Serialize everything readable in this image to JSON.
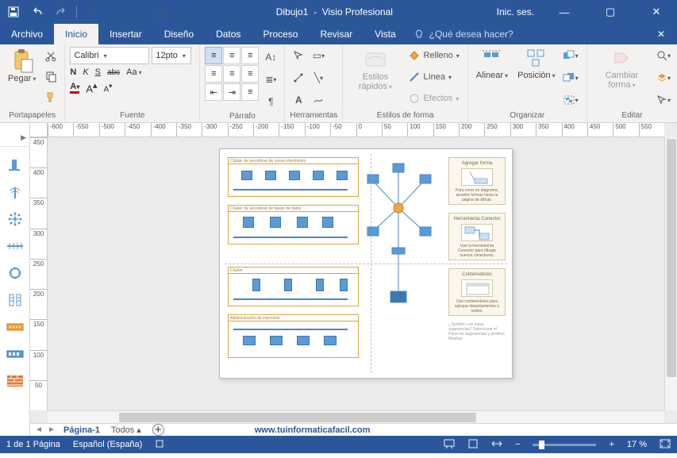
{
  "titlebar": {
    "document_name": "Dibujo1",
    "app_name": "Visio Profesional",
    "signin": "Inic. ses."
  },
  "tabs": {
    "file": "Archivo",
    "home": "Inicio",
    "insert": "Insertar",
    "design": "Diseño",
    "data": "Datos",
    "process": "Proceso",
    "review": "Revisar",
    "view": "Vista",
    "tellme": "¿Qué desea hacer?"
  },
  "ribbon": {
    "clipboard": {
      "label": "Portapapeles",
      "paste": "Pegar"
    },
    "font": {
      "label": "Fuente",
      "name": "Calibri",
      "size": "12pto",
      "bold": "N",
      "italic": "K",
      "underline": "S",
      "strike": "abc",
      "case": "Aa"
    },
    "paragraph": {
      "label": "Párrafo"
    },
    "tools": {
      "label": "Herramientas"
    },
    "shape_styles": {
      "label": "Estilos de forma",
      "quick": "Estilos rápidos",
      "fill": "Relleno",
      "line": "Línea",
      "effects": "Efectos"
    },
    "arrange": {
      "label": "Organizar",
      "align": "Alinear",
      "position": "Posición"
    },
    "edit": {
      "label": "Editar",
      "change_shape": "Cambiar forma"
    }
  },
  "ruler_h": [
    "-600",
    "-550",
    "-500",
    "-450",
    "-400",
    "-350",
    "-300",
    "-250",
    "-200",
    "-150",
    "-100",
    "-50",
    "0",
    "50",
    "100",
    "150",
    "200",
    "250",
    "300",
    "350",
    "400",
    "450",
    "500",
    "550"
  ],
  "ruler_v": [
    "450",
    "400",
    "350",
    "300",
    "250",
    "200",
    "150",
    "100",
    "50"
  ],
  "clusters": {
    "c1": "Clúster de servidores de correo electrónico",
    "c2": "Clúster de servidores de bases de datos",
    "c3": "Clúster",
    "c4": "Administración de impresión"
  },
  "tips": {
    "t1_head": "Agregar forma",
    "t1_body": "Para crear un diagrama, arrastre formas hacia la página de dibujo.",
    "t2_head": "Herramienta Conector",
    "t2_body": "Use la herramienta Conector para dibujar nuevos conectores.",
    "t3_head": "Contenedores",
    "t3_body": "Use contenedores para agrupar departamentos o nodos.",
    "footer": "¿También con estas sugerencias? Seleccione el Panel de sugerencias y prodrna filtrarlas"
  },
  "pagetabs": {
    "page1": "Página-1",
    "all": "Todos",
    "url": "www.tuinformaticafacil.com"
  },
  "statusbar": {
    "pages": "1 de 1 Página",
    "lang": "Español (España)",
    "zoom": "17 %"
  }
}
